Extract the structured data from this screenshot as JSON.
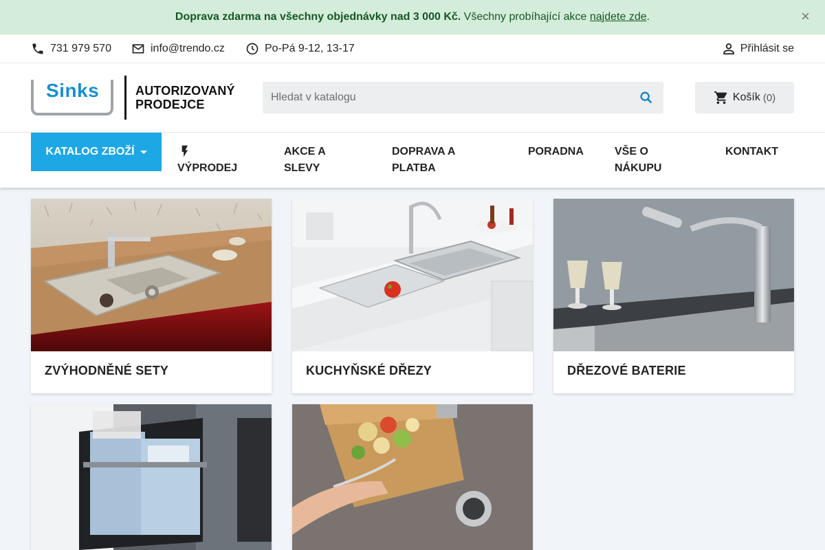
{
  "promo": {
    "bold_text": "Doprava zdarma na všechny objednávky nad 3 000 Kč.",
    "text": " Všechny probíhající akce ",
    "link_text": "najdete zde",
    "suffix": ".",
    "close_glyph": "×"
  },
  "contact": {
    "phone": "731 979 570",
    "email": "info@trendo.cz",
    "hours": "Po-Pá 9-12, 13-17",
    "login_label": "Přihlásit se"
  },
  "header": {
    "logo_brand": "Sinks",
    "logo_line1": "AUTORIZOVANÝ",
    "logo_line2": "PRODEJCE",
    "search_placeholder": "Hledat v katalogu",
    "cart_label": "Košík",
    "cart_count": "(0)"
  },
  "nav": {
    "catalog_label": "KATALOG ZBOŽÍ",
    "items": [
      {
        "line1": "",
        "line2": "VÝPRODEJ",
        "icon": "bolt-icon"
      },
      {
        "line1": "AKCE A",
        "line2": "SLEVY"
      },
      {
        "line1": "DOPRAVA A",
        "line2": "PLATBA"
      },
      {
        "line1": "PORADNA",
        "line2": ""
      },
      {
        "line1": "VŠE O",
        "line2": "NÁKUPU"
      },
      {
        "line1": "KONTAKT",
        "line2": ""
      }
    ]
  },
  "categories": [
    {
      "title": "ZVÝHODNĚNÉ SETY"
    },
    {
      "title": "KUCHYŇSKÉ DŘEZY"
    },
    {
      "title": "DŘEZOVÉ BATERIE"
    },
    {
      "title": ""
    },
    {
      "title": ""
    }
  ],
  "colors": {
    "accent": "#1da7e5",
    "promo_bg": "#d4edda",
    "promo_text": "#155724",
    "brand_blue": "#1a8fd0"
  }
}
